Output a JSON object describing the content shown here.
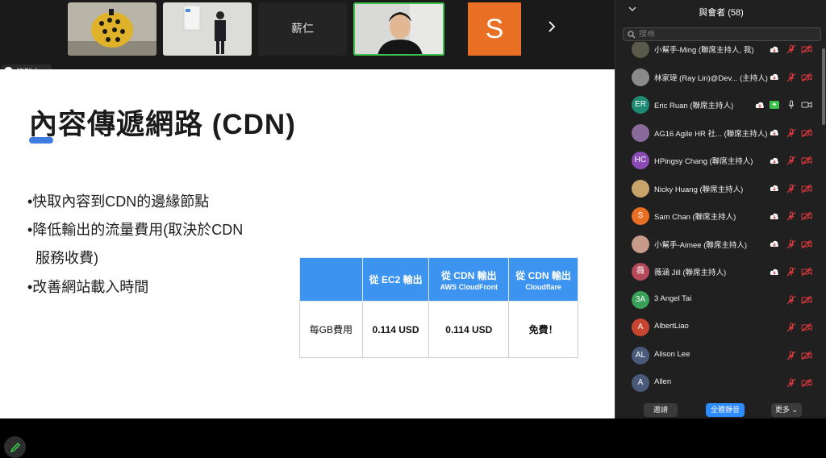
{
  "recording": {
    "label": "錄製中..."
  },
  "video_strip": {
    "speaker_name": "薪仁",
    "s_initial": "S"
  },
  "slide": {
    "title": "內容傳遞網路 (CDN)",
    "bullets": [
      "•快取內容到CDN的邊緣節點",
      "•降低輸出的流量費用(取決於CDN",
      "服務收費)",
      "•改善網站載入時間"
    ],
    "table": {
      "headers": [
        {
          "main": "",
          "sub": ""
        },
        {
          "main": "從 EC2 輸出",
          "sub": ""
        },
        {
          "main": "從 CDN 輸出",
          "sub": "AWS CloudFront"
        },
        {
          "main": "從 CDN 輸出",
          "sub": "Cloudflare"
        }
      ],
      "row": [
        "每GB費用",
        "0.114 USD",
        "0.114 USD",
        "免費！"
      ]
    }
  },
  "participants_panel": {
    "title": "與會者 (58)",
    "search_placeholder": "搜尋",
    "participants": [
      {
        "name": "小幫手-Ming (聯席主持人, 我)",
        "initials": "",
        "color": "#5a5a4a"
      },
      {
        "name": "林家瑋 (Ray Lin)@Dev... (主持人)",
        "initials": "",
        "color": "#8a8a8a"
      },
      {
        "name": "Eric Ruan (聯席主持人)",
        "initials": "ER",
        "color": "#1e8a74"
      },
      {
        "name": "AG16 Agile HR 社... (聯席主持人)",
        "initials": "",
        "color": "#8a6a9a"
      },
      {
        "name": "HPingsy Chang (聯席主持人)",
        "initials": "HC",
        "color": "#8a4bb5"
      },
      {
        "name": "Nicky Huang (聯席主持人)",
        "initials": "",
        "color": "#c9a46a"
      },
      {
        "name": "Sam Chan (聯席主持人)",
        "initials": "S",
        "color": "#e86f24"
      },
      {
        "name": "小幫手-Aimee (聯席主持人)",
        "initials": "",
        "color": "#c79a8a"
      },
      {
        "name": "薇涵 Jill (聯席主持人)",
        "initials": "薇",
        "color": "#b5495a"
      },
      {
        "name": "3 Angel Tai",
        "initials": "3A",
        "color": "#3aa15a"
      },
      {
        "name": "AlbertLiao",
        "initials": "A",
        "color": "#c8462f"
      },
      {
        "name": "Alison Lee",
        "initials": "AL",
        "color": "#4a5a7a"
      },
      {
        "name": "Allen",
        "initials": "A",
        "color": "#4a5a7a"
      }
    ],
    "footer": {
      "invite": "邀請",
      "mute_all": "全體靜音",
      "more": "更多"
    }
  },
  "colors": {
    "accent": "#3d94f0",
    "panel_bg": "#202020",
    "mute_red": "#e0393e"
  }
}
